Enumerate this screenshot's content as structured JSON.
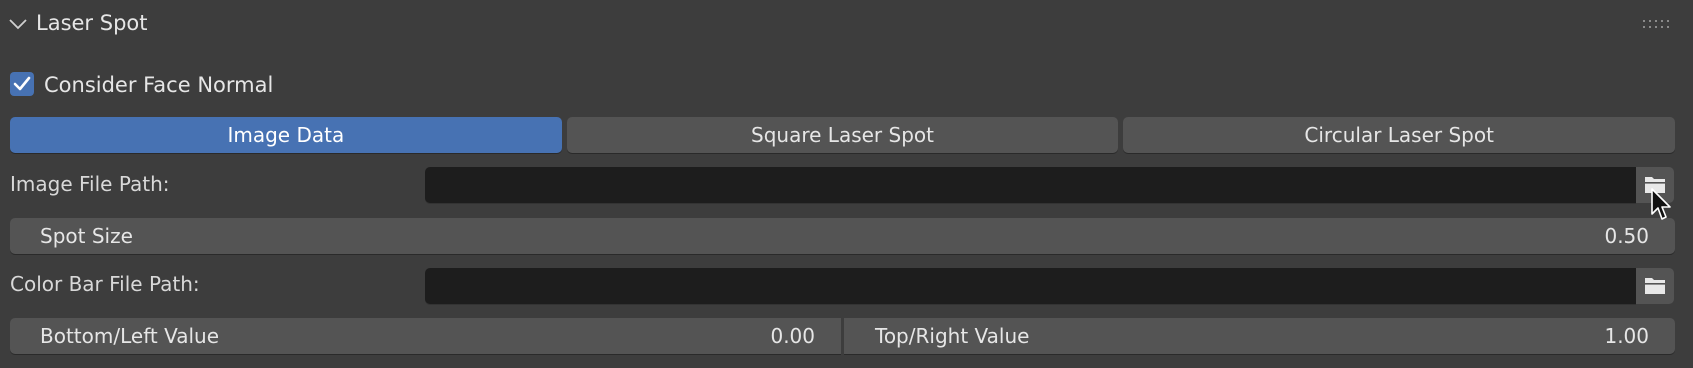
{
  "panel": {
    "title": "Laser Spot",
    "collapse_icon": "chevron-down-icon",
    "grip_icon": "drag-handle-icon"
  },
  "consider_face_normal": {
    "label": "Consider Face Normal",
    "checked": true
  },
  "tabs": [
    {
      "label": "Image Data",
      "active": true
    },
    {
      "label": "Square Laser Spot",
      "active": false
    },
    {
      "label": "Circular Laser Spot",
      "active": false
    }
  ],
  "image_file_path": {
    "label": "Image File Path:",
    "value": "",
    "browse_icon": "folder-icon"
  },
  "spot_size": {
    "label": "Spot Size",
    "value": "0.50"
  },
  "color_bar_file_path": {
    "label": "Color Bar File Path:",
    "value": "",
    "browse_icon": "folder-icon"
  },
  "range": {
    "bottom_left": {
      "label": "Bottom/Left Value",
      "value": "0.00"
    },
    "top_right": {
      "label": "Top/Right Value",
      "value": "1.00"
    }
  },
  "colors": {
    "background": "#3d3d3d",
    "accent": "#4772b3",
    "field_dark": "#1d1d1d",
    "widget": "#545454"
  }
}
